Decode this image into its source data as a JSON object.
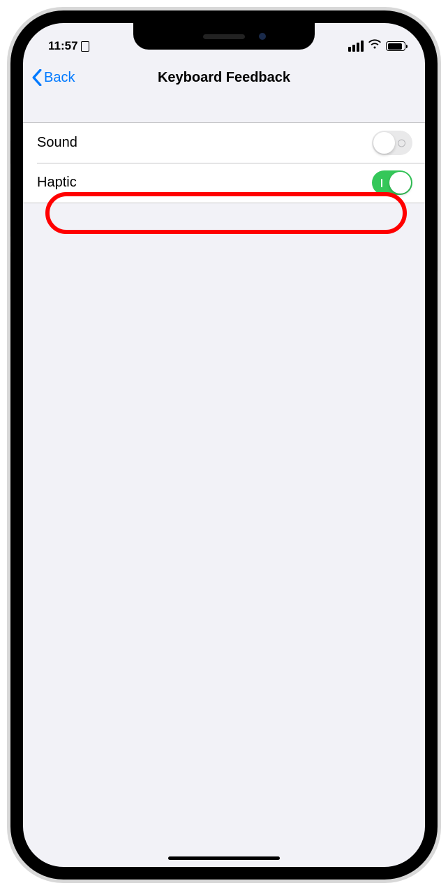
{
  "status": {
    "time": "11:57",
    "has_card_icon": true
  },
  "nav": {
    "back_label": "Back",
    "title": "Keyboard Feedback"
  },
  "settings": {
    "rows": [
      {
        "label": "Sound",
        "on": false
      },
      {
        "label": "Haptic",
        "on": true
      }
    ]
  },
  "annotation": {
    "highlighted_row_index": 1,
    "color": "#ff0000"
  }
}
